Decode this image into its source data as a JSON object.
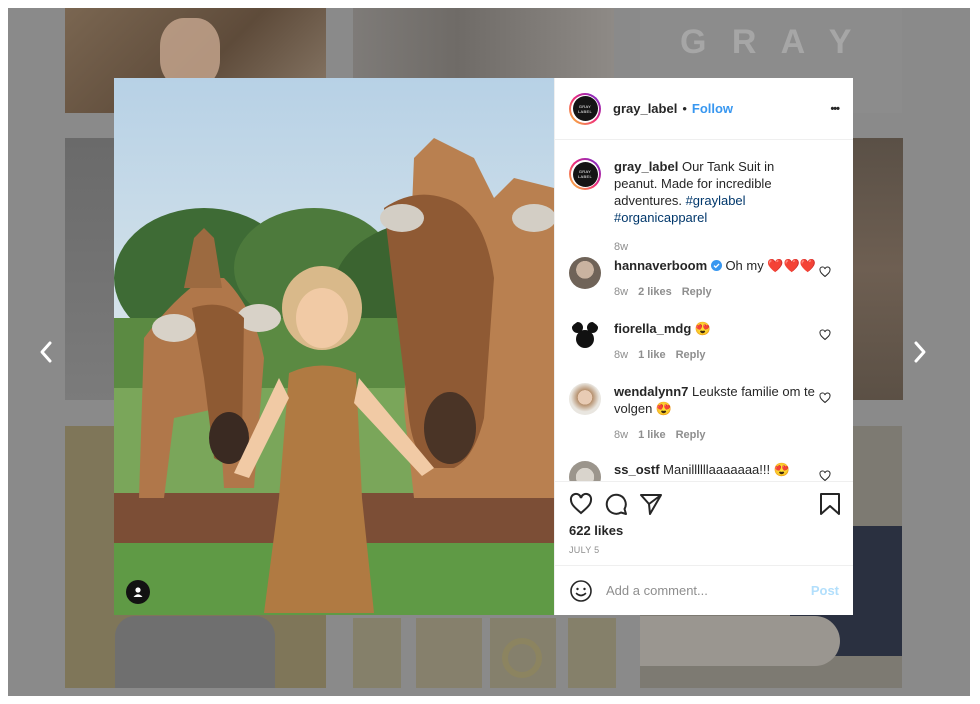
{
  "post": {
    "username": "gray_label",
    "follow_label": "Follow",
    "more_label": "•••",
    "caption": {
      "username": "gray_label",
      "text": "Our Tank Suit in peanut. Made for incredible adventures.",
      "hashtags": "#graylabel #organicapparel",
      "time": "8w"
    },
    "avatar_text": "GRAY LABEL",
    "comments": [
      {
        "username": "hannaverboom",
        "verified": true,
        "text": "Oh my ❤️❤️❤️",
        "time": "8w",
        "likes": "2 likes",
        "reply": "Reply"
      },
      {
        "username": "fiorella_mdg",
        "verified": false,
        "text": "😍",
        "time": "8w",
        "likes": "1 like",
        "reply": "Reply"
      },
      {
        "username": "wendalynn7",
        "verified": false,
        "text": "Leukste familie om te volgen 😍",
        "time": "8w",
        "likes": "1 like",
        "reply": "Reply"
      },
      {
        "username": "ss_ostf",
        "verified": false,
        "text": "Manillllllaaaaaaa!!! 😍",
        "time": "",
        "likes": "",
        "reply": ""
      }
    ],
    "likes": "622 likes",
    "date": "JULY 5",
    "comment_placeholder": "Add a comment...",
    "post_label": "Post"
  },
  "background": {
    "top_center_text": "G R A Y"
  },
  "colors": {
    "accent": "#3897f0",
    "post_disabled": "#b2dffc"
  }
}
